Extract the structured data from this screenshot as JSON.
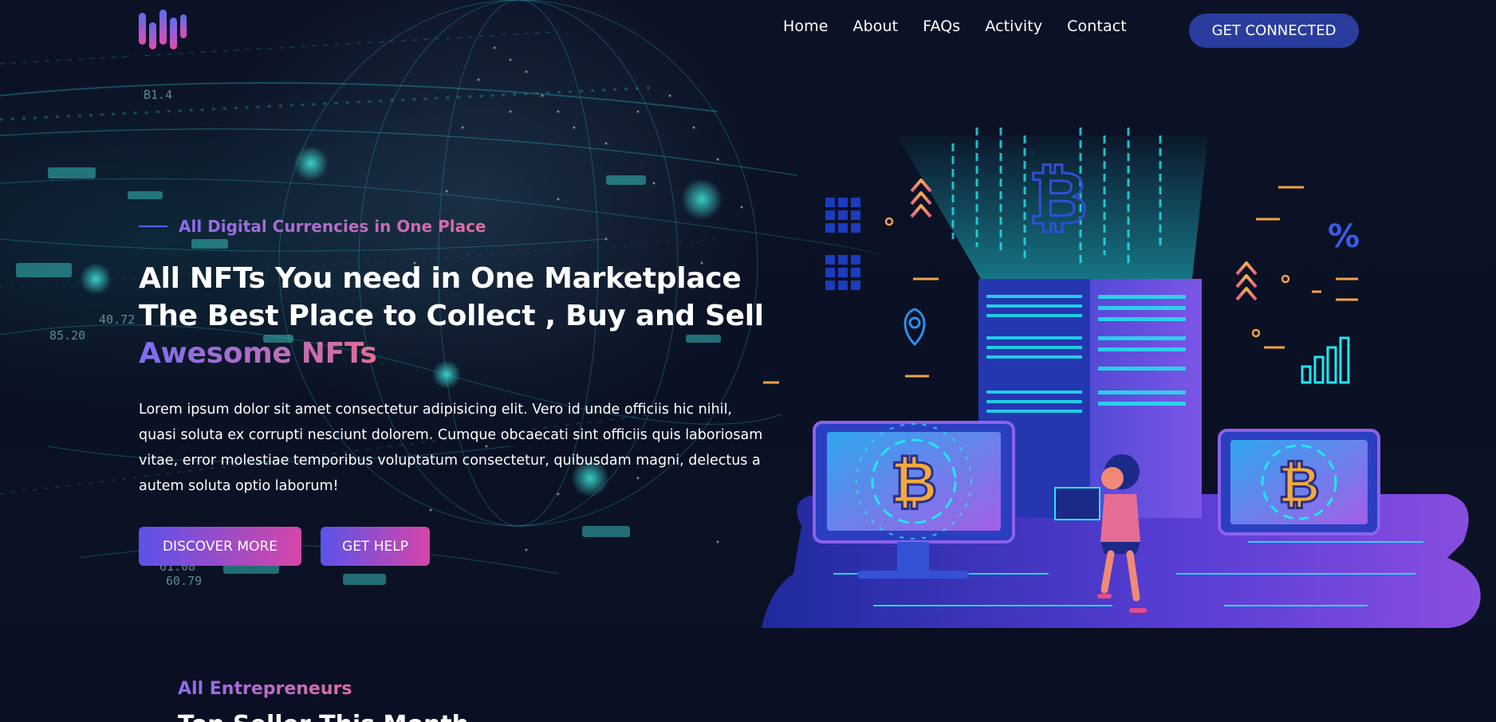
{
  "nav": {
    "links": [
      "Home",
      "About",
      "FAQs",
      "Activity",
      "Contact"
    ],
    "cta_label": "GET CONNECTED"
  },
  "hero": {
    "eyebrow": "All Digital Currencies in One Place",
    "headline_plain": "All NFTs You need in One Marketplace The Best Place to Collect , Buy and Sell ",
    "headline_highlight": "Awesome NFTs",
    "lede": "Lorem ipsum dolor sit amet consectetur adipisicing elit. Vero id unde officiis hic nihil, quasi soluta ex corrupti nesciunt dolorem. Cumque obcaecati sint officiis quis laboriosam vitae, error molestiae temporibus voluptatum consectetur, quibusdam magni, delectus a autem soluta optio laborum!",
    "primary_button": "DISCOVER MORE",
    "secondary_button": "GET HELP"
  },
  "background_readouts": [
    "40.72",
    "85.20",
    "60.79",
    "61.08",
    "B1.4"
  ],
  "illustration": {
    "symbols": [
      "₿",
      "₿",
      "₿",
      "%"
    ]
  },
  "next_section": {
    "eyebrow": "All Entrepreneurs",
    "title": "Top Seller This Month"
  },
  "colors": {
    "background": "#0b0f24",
    "accent_blue": "#2a3d9e",
    "gradient_start": "#5b52ea",
    "gradient_end": "#d646a8",
    "cyan": "#22e6f0"
  }
}
